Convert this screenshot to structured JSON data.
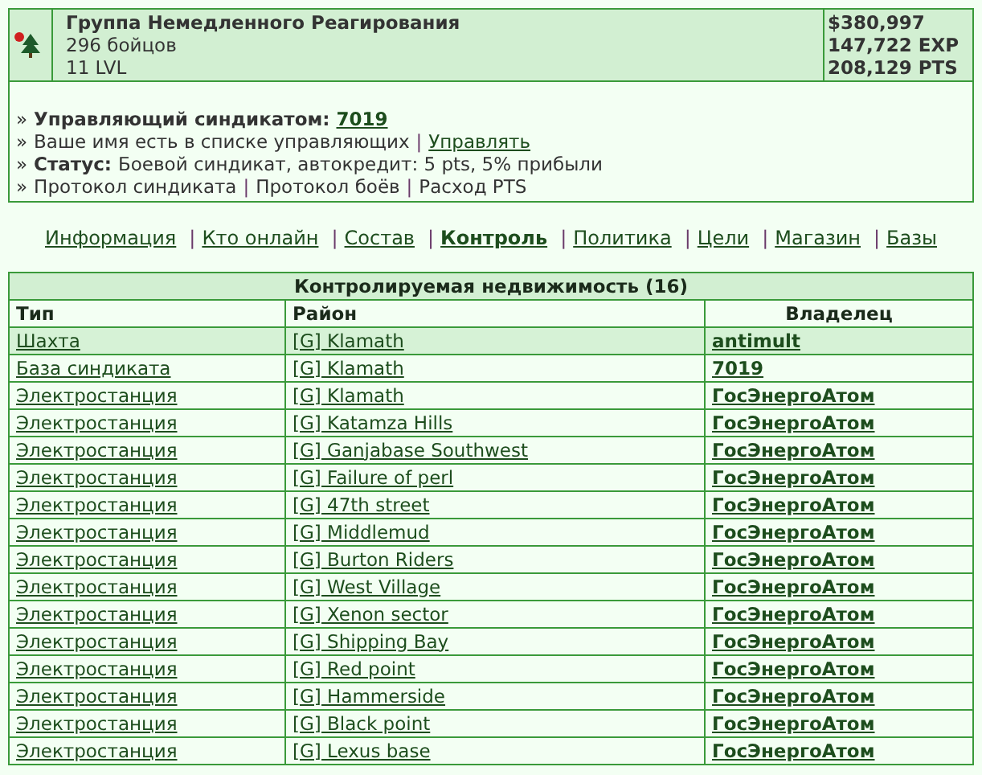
{
  "syndicate": {
    "name": "Группа Немедленного Реагирования",
    "members": "296 бойцов",
    "level": "11 LVL",
    "money": "$380,997",
    "exp": "147,722 EXP",
    "pts": "208,129 PTS"
  },
  "info_lines": [
    {
      "parts": [
        {
          "kind": "text",
          "text": "»"
        },
        {
          "kind": "bold",
          "text": "Управляющий синдикатом:"
        },
        {
          "kind": "boldlink",
          "text": "7019"
        }
      ]
    },
    {
      "parts": [
        {
          "kind": "text",
          "text": "»"
        },
        {
          "kind": "text",
          "text": "Ваше имя есть в списке управляющих"
        },
        {
          "kind": "sep",
          "text": "|"
        },
        {
          "kind": "link",
          "text": "Управлять"
        }
      ]
    },
    {
      "parts": [
        {
          "kind": "text",
          "text": "»"
        },
        {
          "kind": "bold",
          "text": "Статус:"
        },
        {
          "kind": "text",
          "text": "Боевой синдикат, автокредит: 5 pts, 5% прибыли"
        }
      ]
    },
    {
      "parts": [
        {
          "kind": "text",
          "text": "»"
        },
        {
          "kind": "text",
          "text": "Протокол синдиката"
        },
        {
          "kind": "sep",
          "text": "|"
        },
        {
          "kind": "text",
          "text": "Протокол боёв"
        },
        {
          "kind": "sep",
          "text": "|"
        },
        {
          "kind": "text",
          "text": "Расход PTS"
        }
      ]
    }
  ],
  "nav": [
    {
      "label": "Информация",
      "selected": false
    },
    {
      "sep": "|",
      "label": "Кто онлайн",
      "selected": false
    },
    {
      "sep": "|",
      "label": "Состав",
      "selected": false
    },
    {
      "sep": "|",
      "label": "Контроль",
      "selected": true
    },
    {
      "sep": "|",
      "label": "Политика",
      "selected": false
    },
    {
      "sep": "|",
      "label": "Цели",
      "selected": false
    },
    {
      "sep": "|",
      "label": "Магазин",
      "selected": false
    },
    {
      "sep": "|",
      "label": "Базы",
      "selected": false
    }
  ],
  "table": {
    "title": "Контролируемая недвижимость (16)",
    "columns": [
      "Тип",
      "Район",
      "Владелец"
    ],
    "rows": [
      {
        "type": "Шахта",
        "district": "[G] Klamath",
        "owner": "antimult",
        "highlighted": true
      },
      {
        "type": "База синдиката",
        "district": "[G] Klamath",
        "owner": "7019",
        "highlighted": false
      },
      {
        "type": "Электростанция",
        "district": "[G] Klamath",
        "owner": "ГосЭнергоАтом",
        "highlighted": false
      },
      {
        "type": "Электростанция",
        "district": "[G] Katamza Hills",
        "owner": "ГосЭнергоАтом",
        "highlighted": false
      },
      {
        "type": "Электростанция",
        "district": "[G] Ganjabase Southwest",
        "owner": "ГосЭнергоАтом",
        "highlighted": false
      },
      {
        "type": "Электростанция",
        "district": "[G] Failure of perl",
        "owner": "ГосЭнергоАтом",
        "highlighted": false
      },
      {
        "type": "Электростанция",
        "district": "[G] 47th street",
        "owner": "ГосЭнергоАтом",
        "highlighted": false
      },
      {
        "type": "Электростанция",
        "district": "[G] Middlemud",
        "owner": "ГосЭнергоАтом",
        "highlighted": false
      },
      {
        "type": "Электростанция",
        "district": "[G] Burton Riders",
        "owner": "ГосЭнергоАтом",
        "highlighted": false
      },
      {
        "type": "Электростанция",
        "district": "[G] West Village",
        "owner": "ГосЭнергоАтом",
        "highlighted": false
      },
      {
        "type": "Электростанция",
        "district": "[G] Xenon sector",
        "owner": "ГосЭнергоАтом",
        "highlighted": false
      },
      {
        "type": "Электростанция",
        "district": "[G] Shipping Bay",
        "owner": "ГосЭнергоАтом",
        "highlighted": false
      },
      {
        "type": "Электростанция",
        "district": "[G] Red point",
        "owner": "ГосЭнергоАтом",
        "highlighted": false
      },
      {
        "type": "Электростанция",
        "district": "[G] Hammerside",
        "owner": "ГосЭнергоАтом",
        "highlighted": false
      },
      {
        "type": "Электростанция",
        "district": "[G] Black point",
        "owner": "ГосЭнергоАтом",
        "highlighted": false
      },
      {
        "type": "Электростанция",
        "district": "[G] Lexus base",
        "owner": "ГосЭнергоАтом",
        "highlighted": false
      }
    ]
  }
}
